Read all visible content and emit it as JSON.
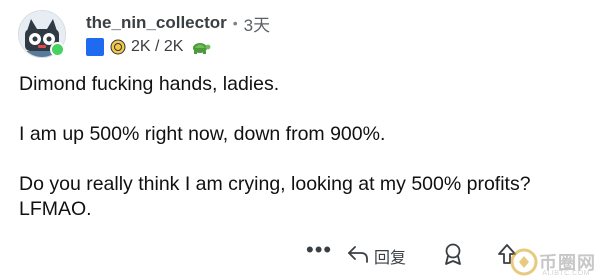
{
  "header": {
    "username": "the_nin_collector",
    "separator": "•",
    "time": "3天",
    "karma": "2K / 2K"
  },
  "icons": {
    "avatar": "cat-avatar",
    "flair": "blue-square",
    "coin": "coin-icon",
    "turtle": "turtle-icon"
  },
  "body": {
    "para1": "Dimond fucking hands, ladies.",
    "para2": "I am up 500% right now, down from 900%.",
    "para3": "Do you really think I am crying, looking at my 500% profits? LFMAO."
  },
  "actions": {
    "more": "•••",
    "reply_label": "回复"
  },
  "watermark": {
    "title": "币圈网",
    "url": "ALIBTC.COM"
  },
  "colors": {
    "flair_blue": "#1e6bf0",
    "online_green": "#46d160",
    "text": "#111111"
  }
}
